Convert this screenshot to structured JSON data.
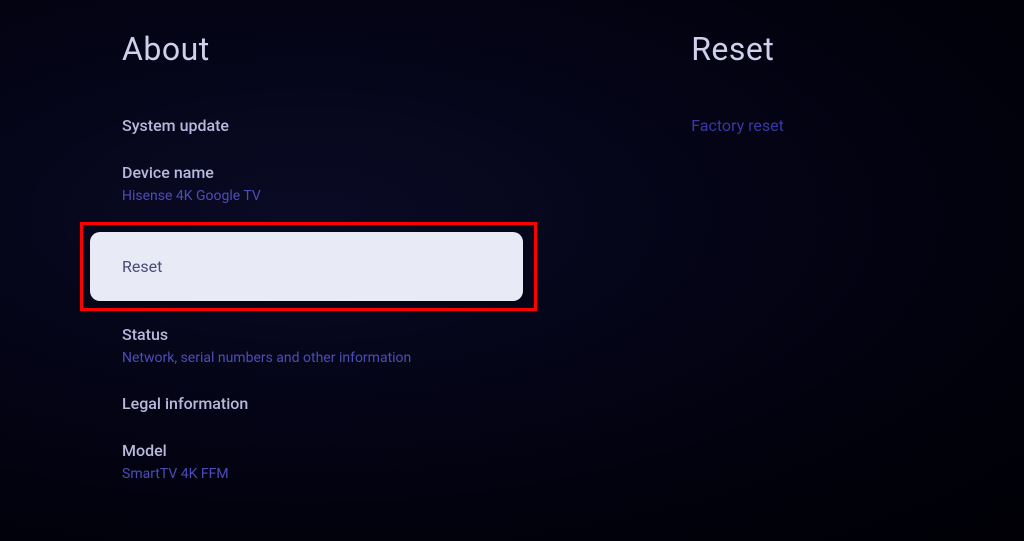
{
  "left": {
    "title": "About",
    "system_update_label": "System update",
    "device_name_label": "Device name",
    "device_name_value": "Hisense 4K Google TV",
    "reset_label": "Reset",
    "status_label": "Status",
    "status_subtitle": "Network, serial numbers and other information",
    "legal_label": "Legal information",
    "model_label": "Model",
    "model_value": "SmartTV 4K FFM"
  },
  "right": {
    "title": "Reset",
    "factory_reset_label": "Factory reset"
  }
}
